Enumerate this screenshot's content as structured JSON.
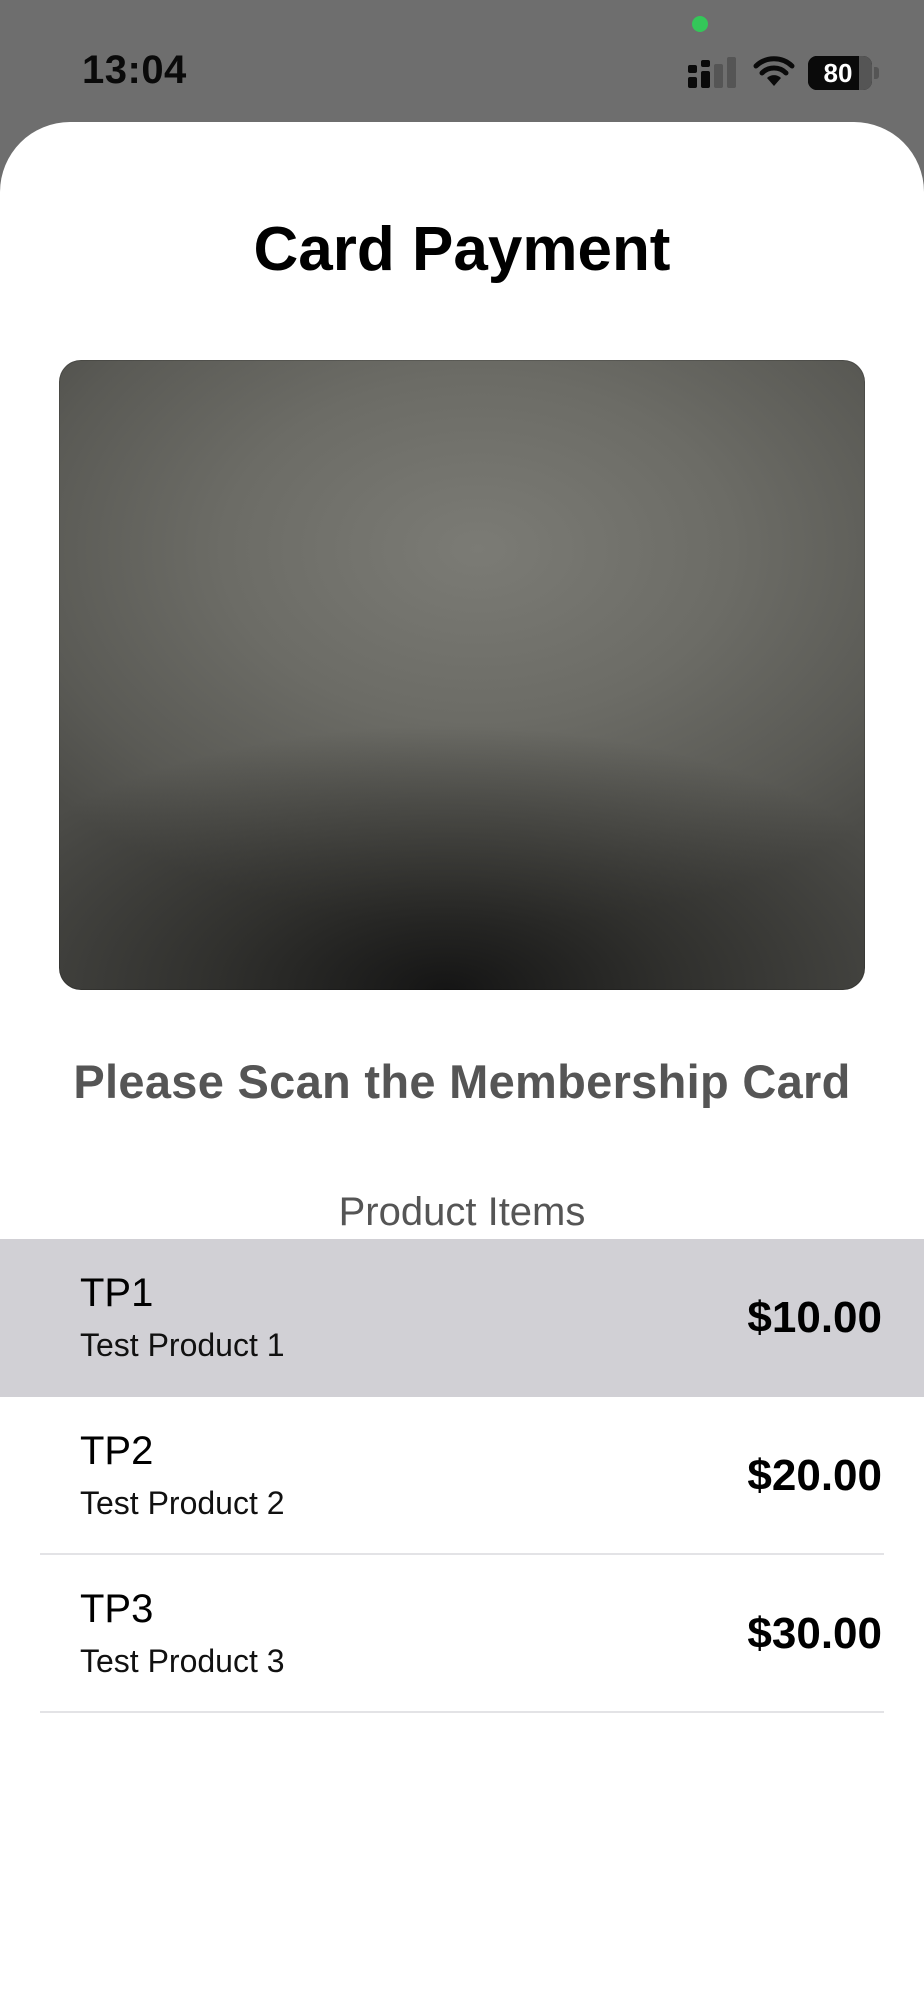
{
  "status_bar": {
    "time": "13:04",
    "battery": "80",
    "battery_level": 0.8,
    "privacy_indicator_color": "#34c759"
  },
  "page": {
    "title": "Card Payment",
    "scan_prompt": "Please Scan the Membership Card",
    "section_title": "Product Items"
  },
  "products": [
    {
      "code": "TP1",
      "name": "Test Product 1",
      "price": "$10.00",
      "selected": true
    },
    {
      "code": "TP2",
      "name": "Test Product 2",
      "price": "$20.00",
      "selected": false
    },
    {
      "code": "TP3",
      "name": "Test Product 3",
      "price": "$30.00",
      "selected": false
    }
  ],
  "icons": {
    "signal": "cellular-signal-icon",
    "wifi": "wifi-icon",
    "battery": "battery-icon"
  },
  "colors": {
    "selected_row": "#d1d0d5",
    "backdrop": "#6e6e6e"
  }
}
